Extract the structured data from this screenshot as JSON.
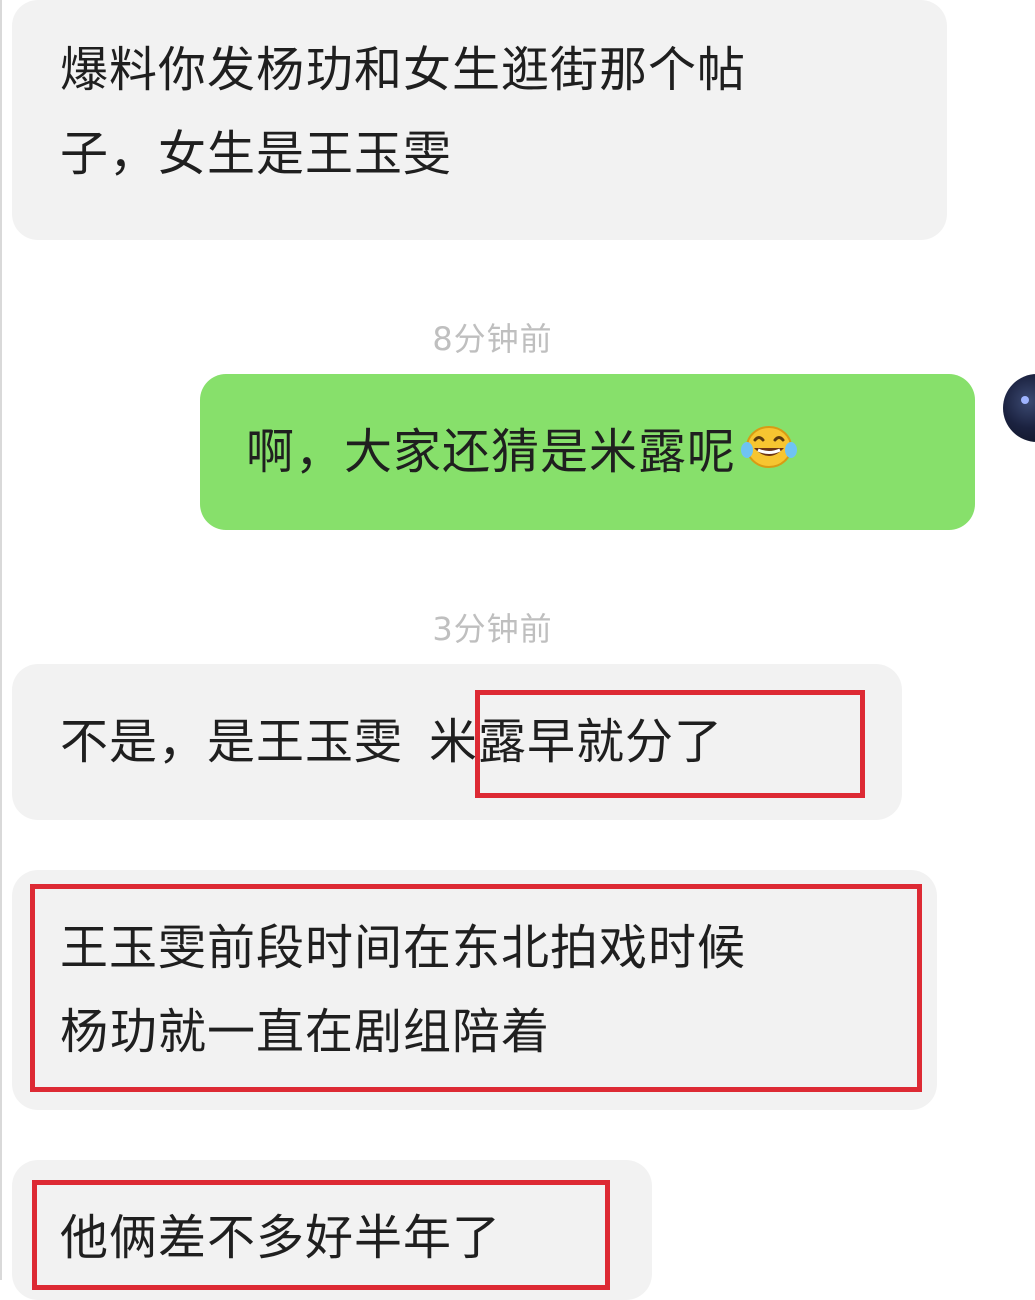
{
  "messages": [
    {
      "line1": "爆料你发杨玏和女生逛街那个帖",
      "line2": "子，女生是王玉雯"
    },
    {
      "timestamp": "8分钟前",
      "text": "啊，大家还猜是米露呢",
      "emoji": "laughing-tears-emoji"
    },
    {
      "timestamp": "3分钟前",
      "text_plain": "不是，是王玉雯",
      "text_highlight": "米露早就分了"
    },
    {
      "line1": "王玉雯前段时间在东北拍戏时候",
      "line2": "杨玏就一直在剧组陪着"
    },
    {
      "text": "他俩差不多好半年了"
    }
  ],
  "colors": {
    "incoming_bubble": "#f2f2f2",
    "outgoing_bubble": "#87e06b",
    "highlight_box": "#dd2a34",
    "timestamp": "#bfbfbf"
  }
}
